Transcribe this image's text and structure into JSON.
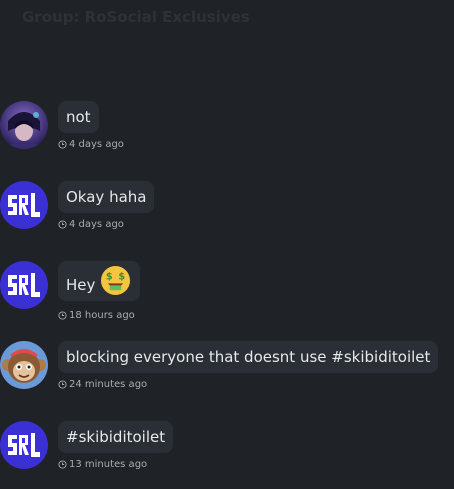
{
  "group": {
    "title": "Group: RoSocial Exclusives"
  },
  "messages": [
    {
      "author_avatar": "anime-character-avatar",
      "text": "not",
      "time": "4 days ago"
    },
    {
      "author_avatar": "srl-logo-avatar",
      "text": "Okay haha",
      "time": "4 days ago"
    },
    {
      "author_avatar": "srl-logo-avatar",
      "text": "Hey",
      "emoji": "money-mouth-face-emoji",
      "time": "18 hours ago"
    },
    {
      "author_avatar": "monkey-character-avatar",
      "text": "blocking everyone that doesnt use #skibiditoilet",
      "time": "24 minutes ago"
    },
    {
      "author_avatar": "srl-logo-avatar",
      "text": "#skibiditoilet",
      "time": "13 minutes ago"
    }
  ],
  "colors": {
    "background": "#1f2328",
    "bubble": "#2a2f35",
    "srl_avatar": "#3b2fd6",
    "timestamp": "#a8adb3"
  }
}
